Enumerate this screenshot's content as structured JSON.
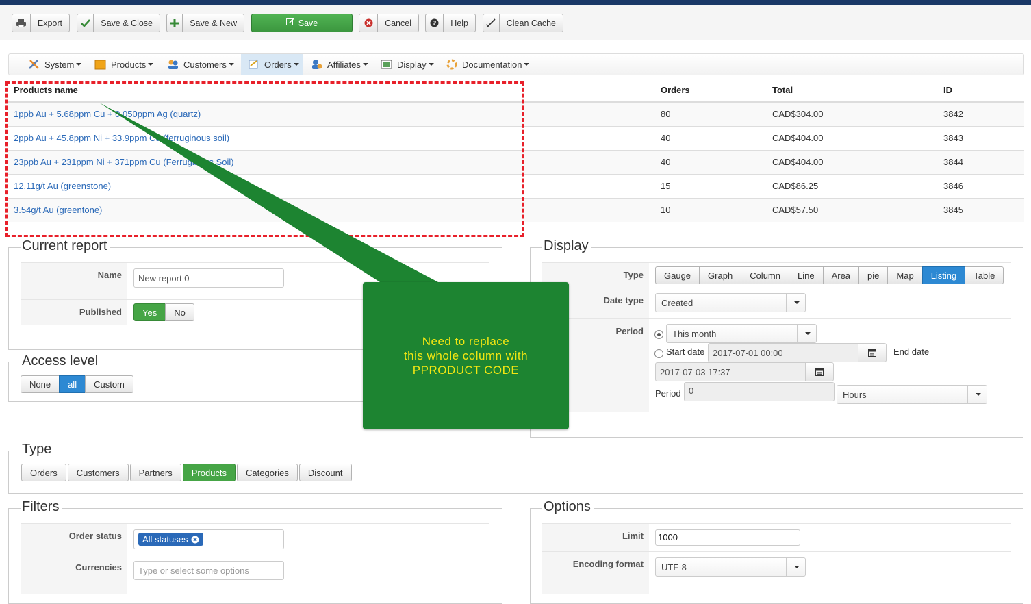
{
  "toolbar": {
    "export": "Export",
    "save_close": "Save & Close",
    "save_new": "Save & New",
    "save": "Save",
    "cancel": "Cancel",
    "help": "Help",
    "clean_cache": "Clean Cache"
  },
  "menu": {
    "items": [
      {
        "label": "System"
      },
      {
        "label": "Products"
      },
      {
        "label": "Customers"
      },
      {
        "label": "Orders"
      },
      {
        "label": "Affiliates"
      },
      {
        "label": "Display"
      },
      {
        "label": "Documentation"
      }
    ],
    "active": "Orders"
  },
  "table": {
    "headers": [
      "Products name",
      "Orders",
      "Total",
      "ID"
    ],
    "rows": [
      [
        "1ppb Au + 5.68ppm Cu + 0.050ppm Ag (quartz)",
        "80",
        "CAD$304.00",
        "3842"
      ],
      [
        "2ppb Au + 45.8ppm Ni + 33.9ppm Cu (ferruginous soil)",
        "40",
        "CAD$404.00",
        "3843"
      ],
      [
        "23ppb Au + 231ppm Ni + 371ppm Cu (Ferruginous Soil)",
        "40",
        "CAD$404.00",
        "3844"
      ],
      [
        "12.11g/t Au (greenstone)",
        "15",
        "CAD$86.25",
        "3846"
      ],
      [
        "3.54g/t Au (greentone)",
        "10",
        "CAD$57.50",
        "3845"
      ]
    ]
  },
  "callout": {
    "line1": "Need to replace",
    "line2": "this whole column with",
    "line3": "PPRODUCT CODE",
    "color": "#1d8431"
  },
  "current_report": {
    "title": "Current report",
    "name_label": "Name",
    "name_value": "New report 0",
    "published_label": "Published",
    "yes": "Yes",
    "no": "No"
  },
  "access_level": {
    "title": "Access level",
    "options": [
      "None",
      "all",
      "Custom"
    ],
    "selected": "all"
  },
  "display": {
    "title": "Display",
    "type_label": "Type",
    "types": [
      "Gauge",
      "Graph",
      "Column",
      "Line",
      "Area",
      "pie",
      "Map",
      "Listing",
      "Table"
    ],
    "selected_type": "Listing",
    "date_type_label": "Date type",
    "date_type_value": "Created",
    "period_label": "Period",
    "period_value": "This month",
    "start_date_label": "Start date",
    "start_date_value": "2017-07-01 00:00",
    "end_date_label": "End date",
    "end_date_value": "2017-07-03 17:37",
    "period2_label": "Period",
    "period2_value": "0",
    "period2_unit": "Hours"
  },
  "type_section": {
    "title": "Type",
    "options": [
      "Orders",
      "Customers",
      "Partners",
      "Products",
      "Categories",
      "Discount"
    ],
    "selected": "Products"
  },
  "filters": {
    "title": "Filters",
    "order_status_label": "Order status",
    "order_status_chip": "All statuses",
    "currencies_label": "Currencies",
    "currencies_placeholder": "Type or select some options"
  },
  "options": {
    "title": "Options",
    "limit_label": "Limit",
    "limit_value": "1000",
    "encoding_label": "Encoding format",
    "encoding_value": "UTF-8"
  }
}
